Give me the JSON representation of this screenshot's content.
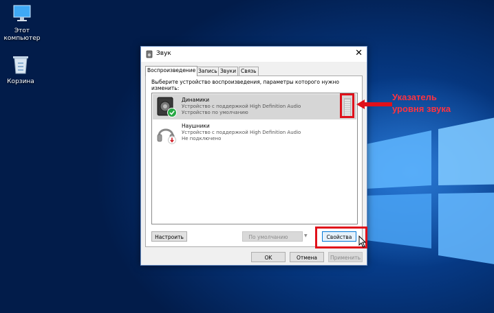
{
  "desktop": {
    "icons": [
      {
        "label_line1": "Этот",
        "label_line2": "компьютер"
      },
      {
        "label_line1": "Корзина",
        "label_line2": ""
      }
    ]
  },
  "dialog": {
    "title": "Звук",
    "tabs": [
      {
        "label": "Воспроизведение"
      },
      {
        "label": "Запись"
      },
      {
        "label": "Звуки"
      },
      {
        "label": "Связь"
      }
    ],
    "instruction": "Выберите устройство воспроизведения, параметры которого нужно изменить:",
    "devices": [
      {
        "name": "Динамики",
        "description": "Устройство с поддержкой High Definition Audio",
        "status": "Устройство по умолчанию",
        "selected": true
      },
      {
        "name": "Наушники",
        "description": "Устройство с поддержкой High Definition Audio",
        "status": "Не подключено",
        "selected": false
      }
    ],
    "buttons": {
      "configure": "Настроить",
      "set_default": "По умолчанию",
      "properties": "Свойства",
      "ok": "OK",
      "cancel": "Отмена",
      "apply": "Применить"
    }
  },
  "annotation": {
    "line1": "Указатель",
    "line2": "уровня звука",
    "color": "#ff3340"
  }
}
